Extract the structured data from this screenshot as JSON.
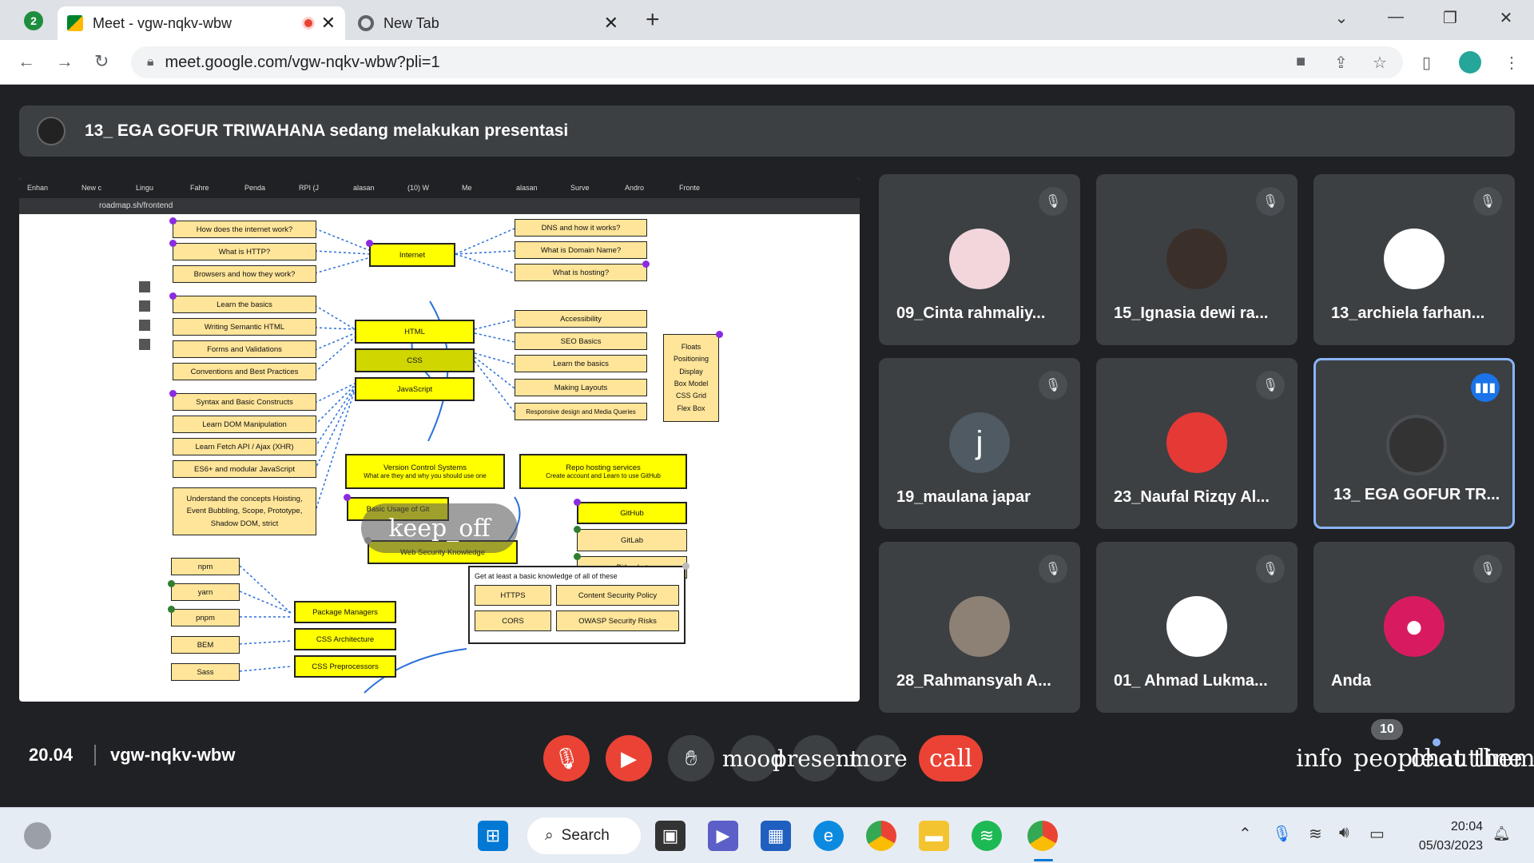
{
  "browser": {
    "tabs": [
      {
        "title": "Meet - vgw-nqkv-wbw",
        "recording": true
      },
      {
        "title": "New Tab"
      }
    ],
    "profile_badge": "2",
    "url": "meet.google.com/vgw-nqkv-wbw?pli=1"
  },
  "meet": {
    "banner": "13_ EGA GOFUR TRIWAHANA sedang melakukan presentasi",
    "presentation": {
      "url": "roadmap.sh/frontend",
      "tab_labels": [
        "Enhan",
        "New c",
        "Lingu",
        "Fahre",
        "Penda",
        "RPI (J",
        "alasan",
        "(10) W",
        "Me",
        "alasan",
        "Surve",
        "Andro",
        "Fronte"
      ],
      "nodes": {
        "internet": "Internet",
        "html": "HTML",
        "css": "CSS",
        "javascript": "JavaScript",
        "vcs_title": "Version Control Systems",
        "vcs_sub": "What are they and why you should use one",
        "repo_title": "Repo hosting services",
        "repo_sub": "Create account and Learn to use GitHub",
        "basic_git": "Basic Usage of Git",
        "github": "GitHub",
        "gitlab": "GitLab",
        "bitbucket": "Bitbucket",
        "web_security": "Web Security Knowledge",
        "package_managers": "Package Managers",
        "css_architecture": "CSS Architecture",
        "css_preprocessors": "CSS Preprocessors",
        "left_items": [
          "How does the internet work?",
          "What is HTTP?",
          "Browsers and how they work?",
          "Learn the basics",
          "Writing Semantic HTML",
          "Forms and Validations",
          "Conventions and Best Practices",
          "Syntax and Basic Constructs",
          "Learn DOM Manipulation",
          "Learn Fetch API / Ajax (XHR)",
          "ES6+ and modular JavaScript"
        ],
        "concepts": "Understand the concepts Hoisting, Event Bubbling, Scope, Prototype, Shadow DOM, strict",
        "right_items": [
          "DNS and how it works?",
          "What is Domain Name?",
          "What is hosting?",
          "Accessibility",
          "SEO Basics",
          "Learn the basics",
          "Making Layouts",
          "Responsive design and Media Queries"
        ],
        "layout_list": [
          "Floats",
          "Positioning",
          "Display",
          "Box Model",
          "CSS Grid",
          "Flex Box"
        ],
        "pm_items": [
          "npm",
          "yarn",
          "pnpm",
          "BEM",
          "Sass"
        ],
        "security_note": "Get at least a basic knowledge of all of these",
        "security_items": [
          "HTTPS",
          "Content Security Policy",
          "CORS",
          "OWASP Security Risks"
        ]
      },
      "overlay_label": "keep_off"
    },
    "participants": [
      {
        "name": "09_Cinta rahmaliy...",
        "muted": true
      },
      {
        "name": "15_Ignasia dewi ra...",
        "muted": true
      },
      {
        "name": "13_archiela farhan...",
        "muted": true
      },
      {
        "name": "19_maulana japar",
        "muted": true,
        "initial": "j"
      },
      {
        "name": "23_Naufal Rizqy Al...",
        "muted": true
      },
      {
        "name": "13_ EGA GOFUR TR...",
        "muted": false,
        "speaking": true
      },
      {
        "name": "28_Rahmansyah A...",
        "muted": true
      },
      {
        "name": "01_ Ahmad Lukma...",
        "muted": true
      },
      {
        "name": "Anda",
        "muted": true
      }
    ],
    "time": "20.04",
    "meeting_code": "vgw-nqkv-wbw",
    "controls": {
      "mood": "mood",
      "present": "present",
      "more": "more",
      "call": "call"
    },
    "right_controls": {
      "info": "info",
      "people": "people",
      "chat": "chat",
      "outline": "outline",
      "theme": "theme"
    },
    "people_count": "10"
  },
  "taskbar": {
    "search_label": "Search",
    "time": "20:04",
    "date": "05/03/2023"
  }
}
